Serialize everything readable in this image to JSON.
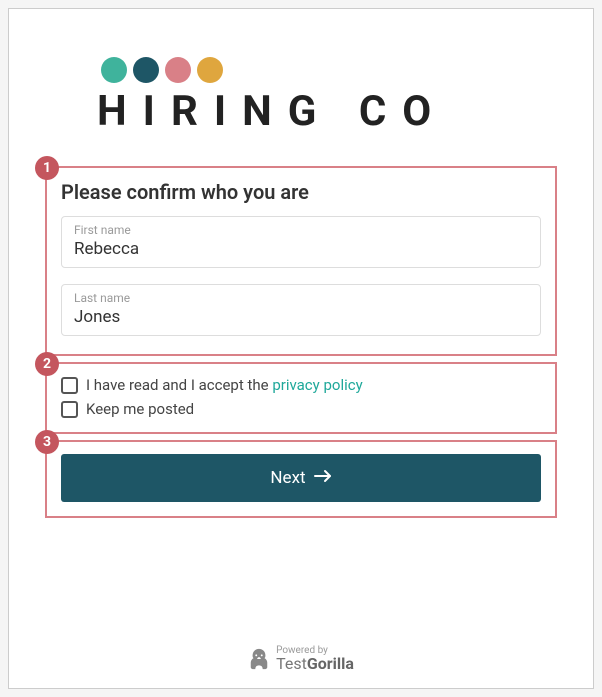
{
  "logo": {
    "text": "HIRING CO"
  },
  "annotations": {
    "box1": "1",
    "box2": "2",
    "box3": "3"
  },
  "form": {
    "heading": "Please confirm who you are",
    "first_name_label": "First name",
    "first_name_value": "Rebecca",
    "last_name_label": "Last name",
    "last_name_value": "Jones"
  },
  "checkboxes": {
    "privacy_prefix": "I have read and I accept the ",
    "privacy_link": "privacy policy",
    "keep_posted": "Keep me posted"
  },
  "button": {
    "next_label": "Next"
  },
  "footer": {
    "powered_label": "Powered by",
    "brand_part1": "Test",
    "brand_part2": "Gorilla"
  }
}
